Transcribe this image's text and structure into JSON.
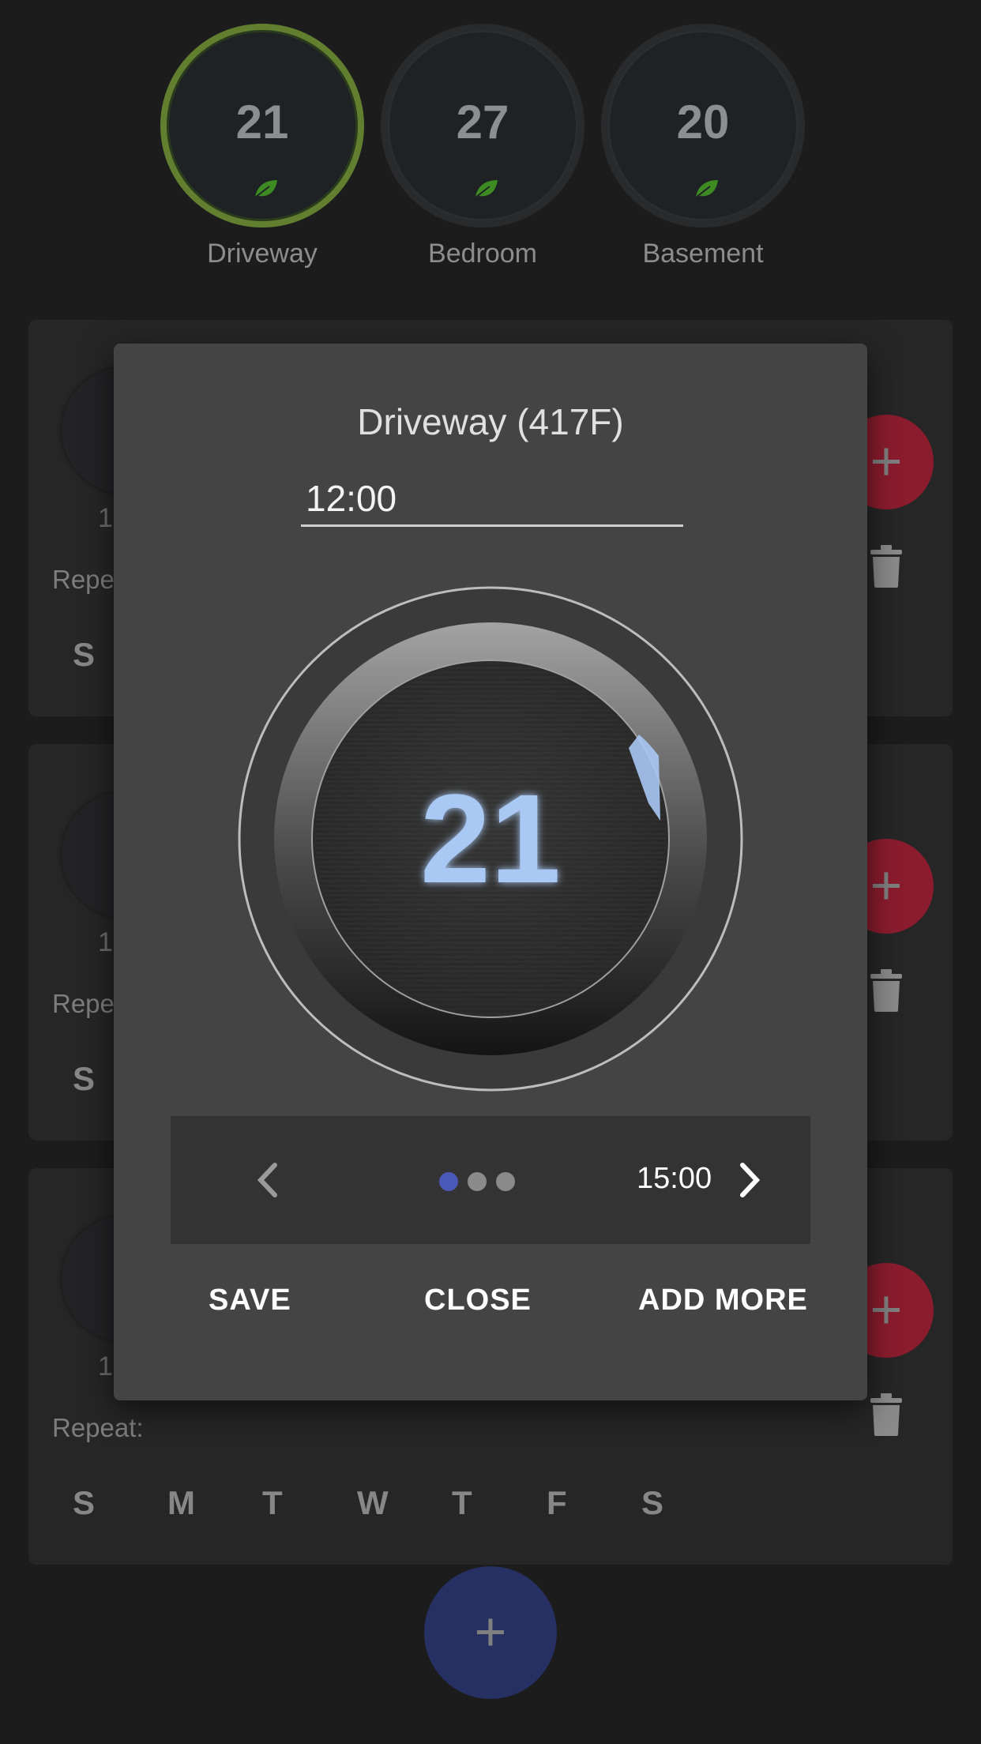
{
  "zones": [
    {
      "name": "Driveway",
      "temp": "21",
      "active": true
    },
    {
      "name": "Bedroom",
      "temp": "27",
      "active": false
    },
    {
      "name": "Basement",
      "temp": "20",
      "active": false
    }
  ],
  "cards": [
    {
      "time_fragment": "1",
      "repeat_label": "Repe",
      "days": [
        "S"
      ]
    },
    {
      "time_fragment": "1",
      "repeat_label": "Repe",
      "days": [
        "S"
      ]
    },
    {
      "time_fragment": "1",
      "repeat_label": "Repeat:",
      "days": [
        "S",
        "M",
        "T",
        "W",
        "T",
        "F",
        "S"
      ]
    }
  ],
  "fab": {
    "add_symbol": "+"
  },
  "dialog": {
    "title": "Driveway (417F)",
    "time_value": "12:00",
    "dial_temp": "21",
    "pager": {
      "next_time": "15:00",
      "page_count": 3,
      "current_page": 1
    },
    "actions": {
      "save": "SAVE",
      "close": "CLOSE",
      "add_more": "ADD MORE"
    }
  },
  "colors": {
    "active_ring": "#617f2e",
    "leaf": "#3d8b22",
    "delete_fab": "#8b1c2e",
    "add_fab": "#263063",
    "page_dot_active": "#4a59b8",
    "dial_digits": "#a9c8f4"
  }
}
